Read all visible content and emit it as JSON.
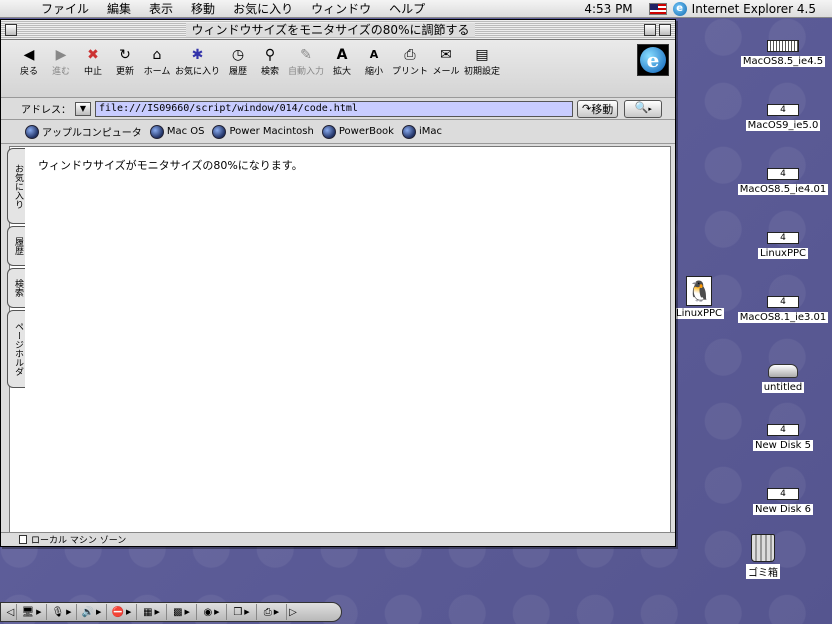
{
  "menubar": {
    "items": [
      "ファイル",
      "編集",
      "表示",
      "移動",
      "お気に入り",
      "ウィンドウ",
      "ヘルプ"
    ],
    "clock": "4:53 PM",
    "app_name": "Internet Explorer 4.5"
  },
  "window": {
    "title": "ウィンドウサイズをモニタサイズの80%に調節する"
  },
  "toolbar": {
    "buttons": [
      {
        "label": "戻る",
        "icon": "back-arrow-icon",
        "enabled": true
      },
      {
        "label": "進む",
        "icon": "forward-arrow-icon",
        "enabled": false
      },
      {
        "label": "中止",
        "icon": "stop-icon",
        "enabled": true
      },
      {
        "label": "更新",
        "icon": "refresh-icon",
        "enabled": true
      },
      {
        "label": "ホーム",
        "icon": "home-icon",
        "enabled": true
      },
      {
        "label": "お気に入り",
        "icon": "favorites-icon",
        "enabled": true
      },
      {
        "label": "履歴",
        "icon": "history-icon",
        "enabled": true
      },
      {
        "label": "検索",
        "icon": "search-icon",
        "enabled": true
      },
      {
        "label": "自動入力",
        "icon": "autofill-icon",
        "enabled": false
      },
      {
        "label": "拡大",
        "icon": "text-larger-icon",
        "enabled": true
      },
      {
        "label": "縮小",
        "icon": "text-smaller-icon",
        "enabled": true
      },
      {
        "label": "プリント",
        "icon": "print-icon",
        "enabled": true
      },
      {
        "label": "メール",
        "icon": "mail-icon",
        "enabled": true
      },
      {
        "label": "初期設定",
        "icon": "preferences-icon",
        "enabled": true
      }
    ]
  },
  "address": {
    "label": "アドレス：",
    "url": "file:///IS09660/script/window/014/code.html",
    "go_label": "移動"
  },
  "favorites": [
    "アップルコンピュータ",
    "Mac OS",
    "Power Macintosh",
    "PowerBook",
    "iMac"
  ],
  "sidetabs": [
    "お気に入り",
    "履歴",
    "検索",
    "ページホルダ"
  ],
  "page": {
    "text": "ウィンドウサイズがモニタサイズの80%になります。"
  },
  "status": {
    "zone": "ローカル マシン ゾーン"
  },
  "desktop_icons": [
    {
      "label": "MacOS8.5_ie4.5",
      "disk": "",
      "kind": "chip"
    },
    {
      "label": "MacOS9_ie5.0",
      "disk": "4",
      "kind": "disk"
    },
    {
      "label": "MacOS8.5_ie4.01",
      "disk": "4",
      "kind": "disk"
    },
    {
      "label": "LinuxPPC",
      "disk": "4",
      "kind": "disk"
    },
    {
      "label": "MacOS8.1_ie3.01",
      "disk": "4",
      "kind": "disk"
    },
    {
      "label": "untitled",
      "disk": "",
      "kind": "hdd"
    },
    {
      "label": "New Disk 5",
      "disk": "4",
      "kind": "disk"
    },
    {
      "label": "New Disk 6",
      "disk": "4",
      "kind": "disk"
    },
    {
      "label": "ゴミ箱",
      "disk": "",
      "kind": "trash"
    }
  ],
  "linux_icon": {
    "label": "LinuxPPC"
  }
}
